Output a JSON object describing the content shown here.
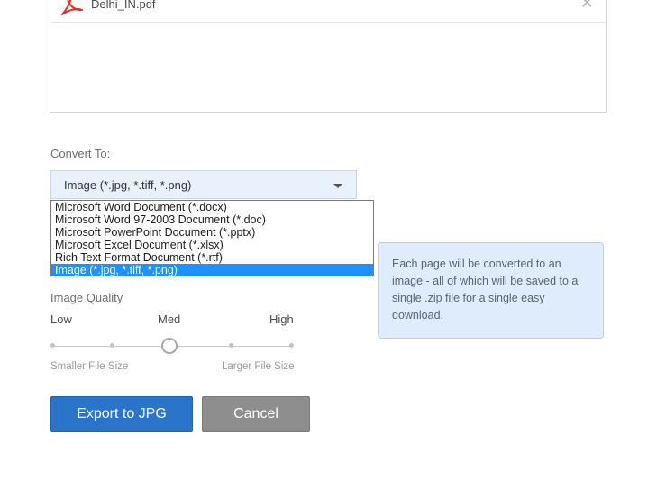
{
  "file": {
    "name": "Delhi_IN.pdf",
    "remove_icon": "close-icon",
    "type_icon": "pdf-icon"
  },
  "convert": {
    "label": "Convert To:",
    "selected": "Image (*.jpg, *.tiff, *.png)",
    "options": [
      "Microsoft Word Document (*.docx)",
      "Microsoft Word 97-2003 Document (*.doc)",
      "Microsoft PowerPoint Document (*.pptx)",
      "Microsoft Excel Document (*.xlsx)",
      "Rich Text Format Document (*.rtf)",
      "Image (*.jpg, *.tiff, *.png)"
    ],
    "highlighted_index": 5
  },
  "tooltip": {
    "text": "Each page will be converted to an image - all of which will be saved to a single .zip file for a single easy download."
  },
  "quality": {
    "label": "Image Quality",
    "low": "Low",
    "med": "Med",
    "high": "High",
    "smaller": "Smaller File Size",
    "larger": "Larger File Size",
    "selected": "Med"
  },
  "actions": {
    "export": "Export to JPG",
    "cancel": "Cancel"
  },
  "colors": {
    "primary": "#2a74c9",
    "secondary": "#8e8e8e",
    "selection": "#1e90ff",
    "pdf_red": "#e0311f"
  }
}
